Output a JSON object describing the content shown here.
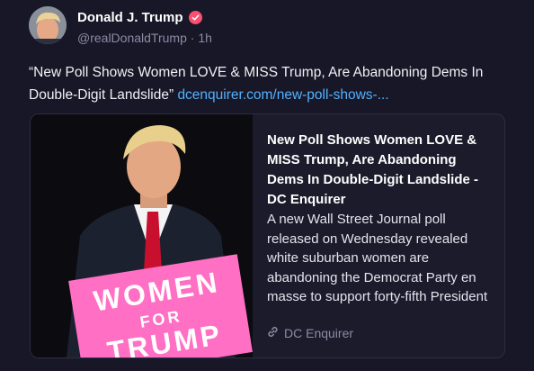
{
  "author": {
    "name": "Donald J. Trump",
    "handle": "@realDonaldTrump",
    "separator": "·",
    "time": "1h"
  },
  "post": {
    "text": "“New Poll Shows Women LOVE & MISS Trump, Are Abandoning Dems In Double-Digit Landslide”",
    "link_text": "dcenquirer.com/new-poll-shows-..."
  },
  "card": {
    "title": "New Poll Shows Women LOVE & MISS Trump, Are Abandoning Dems In Double-Digit Landslide - DC Enquirer",
    "description": "A new Wall Street Journal poll released on Wednesday revealed white suburban women are abandoning the Democrat Party en masse to support forty-fifth President",
    "source": "DC Enquirer",
    "sign_lines": [
      "WOMEN",
      "FOR",
      "TRUMP"
    ]
  },
  "colors": {
    "background": "#171727",
    "link": "#53b1ff",
    "verified_badge": "#ff4f70",
    "sign_pink": "#ff6fc4"
  }
}
